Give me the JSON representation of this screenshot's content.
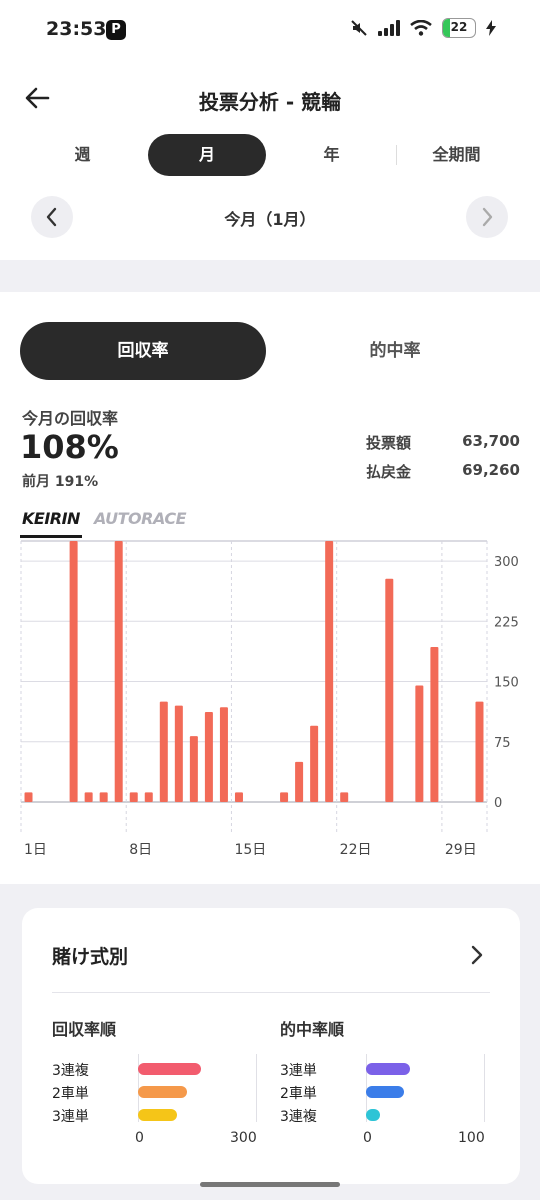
{
  "status_bar": {
    "time": "23:53",
    "app_badge": "P",
    "battery_level": "22",
    "battery_fraction": 0.22
  },
  "header": {
    "title": "投票分析 - 競輪"
  },
  "period_tabs": [
    {
      "label": "週",
      "active": false
    },
    {
      "label": "月",
      "active": true
    },
    {
      "label": "年",
      "active": false
    },
    {
      "label": "全期間",
      "active": false
    }
  ],
  "month_nav": {
    "label": "今月（1月）"
  },
  "metric_tabs": [
    {
      "label": "回収率",
      "active": true
    },
    {
      "label": "的中率",
      "active": false
    }
  ],
  "kpi": {
    "label": "今月の回収率",
    "value": "108%",
    "previous": "前月 191%",
    "stats": [
      {
        "label": "投票額",
        "value": "63,700"
      },
      {
        "label": "払戻金",
        "value": "69,260"
      }
    ]
  },
  "source_tabs": [
    {
      "label": "KEIRIN",
      "active": true
    },
    {
      "label": "AUTORACE",
      "active": false
    }
  ],
  "chart_data": {
    "type": "bar",
    "x": [
      1,
      2,
      3,
      4,
      5,
      6,
      7,
      8,
      9,
      10,
      11,
      12,
      13,
      14,
      15,
      16,
      17,
      18,
      19,
      20,
      21,
      22,
      23,
      24,
      25,
      26,
      27,
      28,
      29,
      30,
      31
    ],
    "values": [
      12,
      0,
      0,
      330,
      12,
      12,
      330,
      12,
      12,
      125,
      120,
      82,
      112,
      118,
      12,
      0,
      0,
      12,
      50,
      95,
      330,
      12,
      0,
      0,
      278,
      0,
      145,
      193,
      0,
      0,
      125
    ],
    "x_tick_labels": [
      "1日",
      "8日",
      "15日",
      "22日",
      "29日"
    ],
    "x_tick_days": [
      1,
      8,
      15,
      22,
      29
    ],
    "y_ticks": [
      "0",
      "75",
      "150",
      "225",
      "300"
    ],
    "y_tick_values": [
      0,
      75,
      150,
      225,
      300
    ],
    "ylim": [
      0,
      325
    ],
    "color": "#f26a57"
  },
  "bet_types": {
    "title": "賭け式別",
    "recovery": {
      "title": "回収率順",
      "items": [
        {
          "label": "3連複",
          "value": 160,
          "color": "#f25c6e"
        },
        {
          "label": "2車単",
          "value": 125,
          "color": "#f5994a"
        },
        {
          "label": "3連単",
          "value": 100,
          "color": "#f5c518"
        }
      ],
      "axis_min": "0",
      "axis_max": "300",
      "max": 300
    },
    "hit": {
      "title": "的中率順",
      "items": [
        {
          "label": "3連単",
          "value": 37,
          "color": "#7b61e8"
        },
        {
          "label": "2車単",
          "value": 32,
          "color": "#3b7de9"
        },
        {
          "label": "3連複",
          "value": 12,
          "color": "#2ec4d6"
        }
      ],
      "axis_min": "0",
      "axis_max": "100",
      "max": 100
    }
  }
}
